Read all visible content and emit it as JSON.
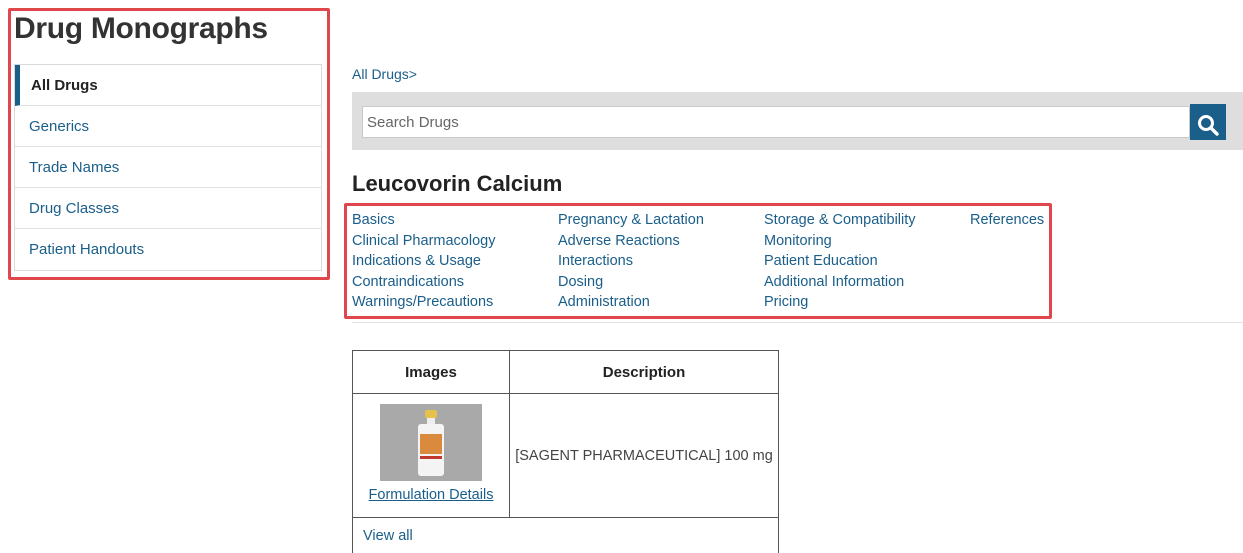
{
  "page_title": "Drug Monographs",
  "sidebar": {
    "items": [
      {
        "label": "All Drugs",
        "active": true
      },
      {
        "label": "Generics"
      },
      {
        "label": "Trade Names"
      },
      {
        "label": "Drug Classes"
      },
      {
        "label": "Patient Handouts"
      }
    ]
  },
  "breadcrumb": "All Drugs>",
  "search": {
    "placeholder": "Search Drugs",
    "button_icon": "search-icon"
  },
  "drug": {
    "name": "Leucovorin Calcium"
  },
  "sections": {
    "col1": [
      "Basics",
      "Clinical Pharmacology",
      "Indications & Usage",
      "Contraindications",
      "Warnings/Precautions"
    ],
    "col2": [
      "Pregnancy & Lactation",
      "Adverse Reactions",
      "Interactions",
      "Dosing",
      "Administration"
    ],
    "col3": [
      "Storage & Compatibility",
      "Monitoring",
      "Patient Education",
      "Additional Information",
      "Pricing"
    ],
    "col4": [
      "References"
    ]
  },
  "images_table": {
    "headers": [
      "Images",
      "Description"
    ],
    "rows": [
      {
        "link": "Formulation Details",
        "description": "[SAGENT PHARMACEUTICAL] 100 mg"
      }
    ],
    "view_all": "View all"
  },
  "colors": {
    "link": "#1a5e8a",
    "highlight": "#e0474c",
    "search_band": "#dedede"
  }
}
